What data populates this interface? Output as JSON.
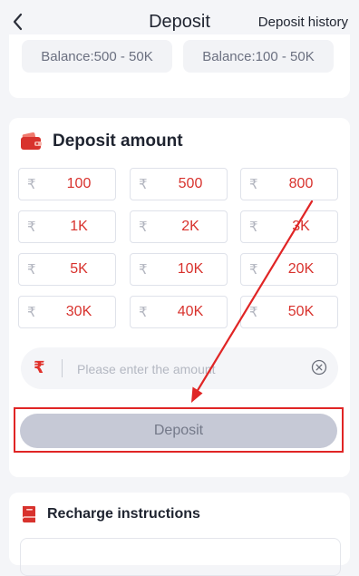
{
  "header": {
    "back_icon": "chevron-left-icon",
    "title": "Deposit",
    "history_label": "Deposit history"
  },
  "balance_ranges": [
    {
      "label": "Balance:500 - 50K"
    },
    {
      "label": "Balance:100 - 50K"
    }
  ],
  "deposit_section": {
    "title": "Deposit amount",
    "icon": "wallet-icon",
    "currency_symbol": "₹",
    "amounts": [
      {
        "label": "100"
      },
      {
        "label": "500"
      },
      {
        "label": "800"
      },
      {
        "label": "1K"
      },
      {
        "label": "2K"
      },
      {
        "label": "3K"
      },
      {
        "label": "5K"
      },
      {
        "label": "10K"
      },
      {
        "label": "20K"
      },
      {
        "label": "30K"
      },
      {
        "label": "40K"
      },
      {
        "label": "50K"
      }
    ],
    "input": {
      "value": "",
      "placeholder": "Please enter the amount"
    },
    "deposit_button_label": "Deposit"
  },
  "instructions": {
    "title": "Recharge instructions",
    "icon": "book-icon"
  },
  "colors": {
    "accent": "#d8322d",
    "annotation": "#e02525",
    "disabled_button": "#c6c9d6"
  }
}
